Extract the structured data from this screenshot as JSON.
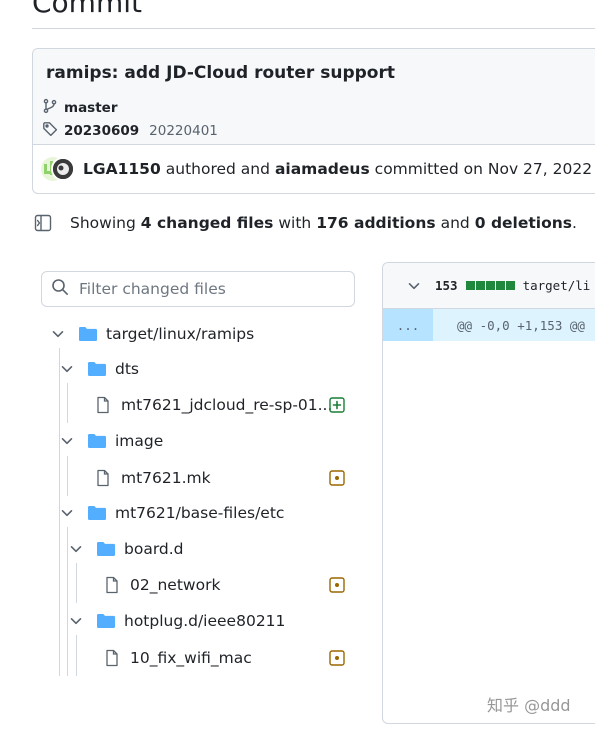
{
  "page": {
    "title": "Commit"
  },
  "commit": {
    "title": "ramips: add JD-Cloud router support",
    "branch": "master",
    "tags": [
      "20230609",
      "20220401"
    ],
    "author": "LGA1150",
    "authored_text": "authored and",
    "committer": "aiamadeus",
    "committed_text": "committed on Nov 27, 2022"
  },
  "summary": {
    "prefix": "Showing",
    "files_changed": "4 changed files",
    "with": "with",
    "additions": "176 additions",
    "and": "and",
    "deletions": "0 deletions",
    "suffix": "."
  },
  "file_filter": {
    "placeholder": "Filter changed files"
  },
  "file_tree": [
    {
      "name": "target/linux/ramips",
      "type": "folder",
      "depth": 0
    },
    {
      "name": "dts",
      "type": "folder",
      "depth": 1
    },
    {
      "name": "mt7621_jdcloud_re-sp-01...",
      "type": "file",
      "depth": 2,
      "status": "added"
    },
    {
      "name": "image",
      "type": "folder",
      "depth": 1
    },
    {
      "name": "mt7621.mk",
      "type": "file",
      "depth": 2,
      "status": "modified"
    },
    {
      "name": "mt7621/base-files/etc",
      "type": "folder",
      "depth": 1
    },
    {
      "name": "board.d",
      "type": "folder",
      "depth": 2
    },
    {
      "name": "02_network",
      "type": "file",
      "depth": 3,
      "status": "modified"
    },
    {
      "name": "hotplug.d/ieee80211",
      "type": "folder",
      "depth": 2
    },
    {
      "name": "10_fix_wifi_mac",
      "type": "file",
      "depth": 3,
      "status": "modified"
    }
  ],
  "diff": {
    "additions_count": "153",
    "file_path": "target/li",
    "expand_label": "...",
    "hunk_header": "@@ -0,0 +1,153 @@"
  },
  "watermark": "知乎 @ddd",
  "colors": {
    "folder": "#54aeff",
    "added": "#1a7f37",
    "modified": "#9a6700",
    "diff_bar": "#1f883d",
    "hunk_bg": "#ddf4ff"
  },
  "icons": {
    "branch": "git-branch-icon",
    "tag": "tag-icon",
    "sidebar_toggle": "sidebar-expand-icon",
    "search": "search-icon",
    "chevron": "chevron-down-icon",
    "folder": "folder-icon",
    "file": "file-icon",
    "added": "diff-added-icon",
    "modified": "diff-modified-icon"
  }
}
